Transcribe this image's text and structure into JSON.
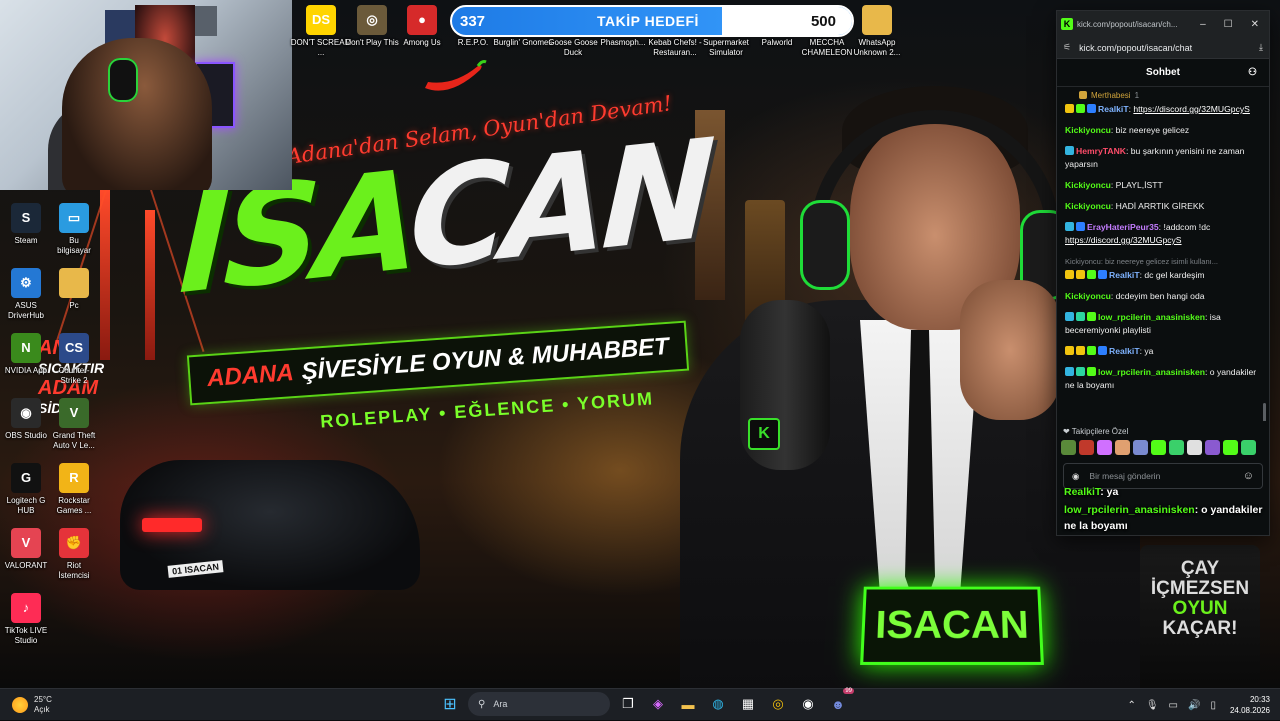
{
  "wallpaper": {
    "brand_left": "ISA",
    "brand_right": "CAN",
    "script_line": "Adana'dan Selam, Oyun'dan Devam!",
    "tagline_accent": "ADANA",
    "tagline_rest": "ŞİVESİYLE OYUN & MUHABBET",
    "subline": "ROLEPLAY • EĞLENCE • YORUM",
    "mic_badge": "K",
    "nameplate": "ISACAN",
    "mug_line1": "ÇAY",
    "mug_line2": "İÇMEZSEN",
    "mug_line3": "OYUN",
    "mug_line4": "KAÇAR!",
    "car_plate": "01 ISACAN",
    "side_text_1": "AN",
    "side_text_2": "SICAKTIR",
    "side_text_3": "ADAM",
    "side_text_4": "SİDİR"
  },
  "desktop_icons": [
    {
      "label": "Steam",
      "icon": "steam-icon",
      "color": "#1b2838",
      "glyph": "S"
    },
    {
      "label": "Bu bilgisayar",
      "icon": "computer-icon",
      "color": "#2a9be0",
      "glyph": "▭"
    },
    {
      "label": "ASUS DriverHub",
      "icon": "asus-icon",
      "color": "#2478d4",
      "glyph": "⚙"
    },
    {
      "label": "Pc",
      "icon": "folder-icon",
      "color": "#e8b84a",
      "glyph": ""
    },
    {
      "label": "NVIDIA App",
      "icon": "nvidia-icon",
      "color": "#3a8a1c",
      "glyph": "N"
    },
    {
      "label": "Counter-Strike 2",
      "icon": "cs2-icon",
      "color": "#2c4a8a",
      "glyph": "CS"
    },
    {
      "label": "OBS Studio",
      "icon": "obs-icon",
      "color": "#2a2a2a",
      "glyph": "◉"
    },
    {
      "label": "Grand Theft Auto V Le...",
      "icon": "gta-icon",
      "color": "#3a6a2a",
      "glyph": "V"
    },
    {
      "label": "Logitech G HUB",
      "icon": "logitech-icon",
      "color": "#111111",
      "glyph": "G"
    },
    {
      "label": "Rockstar Games ...",
      "icon": "rockstar-icon",
      "color": "#f2b417",
      "glyph": "R"
    },
    {
      "label": "VALORANT",
      "icon": "valorant-icon",
      "color": "#e54452",
      "glyph": "V"
    },
    {
      "label": "Riot İstemcisi",
      "icon": "riot-icon",
      "color": "#e5333a",
      "glyph": "✊"
    },
    {
      "label": "TikTok LIVE Studio",
      "icon": "tiktok-icon",
      "color": "#fe2c55",
      "glyph": "♪"
    }
  ],
  "top_icons": [
    {
      "label": "DON'T SCREAM ...",
      "icon": "dont-scream-icon",
      "color": "#ffd400",
      "glyph": "DS"
    },
    {
      "label": "Don't Play This",
      "icon": "dont-play-icon",
      "color": "#6b5a3a",
      "glyph": "◎"
    },
    {
      "label": "Among Us",
      "icon": "among-us-icon",
      "color": "#d62a2a",
      "glyph": "●"
    },
    {
      "label": "R.E.P.O.",
      "icon": "repo-icon",
      "color": "#1e2a34",
      "glyph": ""
    },
    {
      "label": "Burglin' Gnomes",
      "icon": "burglin-gnomes-icon",
      "color": "#4a7a3a",
      "glyph": ""
    },
    {
      "label": "Goose Goose Duck",
      "icon": "goose-icon",
      "color": "#f0c040",
      "glyph": ""
    },
    {
      "label": "Phasmoph...",
      "icon": "phasmophobia-icon",
      "color": "#333333",
      "glyph": ""
    },
    {
      "label": "Kebab Chefs! - Restauran...",
      "icon": "kebab-chefs-icon",
      "color": "#8a3a1a",
      "glyph": ""
    },
    {
      "label": "Supermarket Simulator",
      "icon": "supermarket-icon",
      "color": "#4a6a8a",
      "glyph": "▥"
    },
    {
      "label": "Palworld",
      "icon": "palworld-icon",
      "color": "#5abbd4",
      "glyph": "◕"
    },
    {
      "label": "MECCHA CHAMELEON",
      "icon": "chameleon-icon",
      "color": "#3ab06a",
      "glyph": "☼"
    },
    {
      "label": "WhatsApp Unknown 2...",
      "icon": "folder-icon",
      "color": "#e8b84a",
      "glyph": ""
    }
  ],
  "goal": {
    "current": "337",
    "title": "TAKİP HEDEFİ",
    "target": "500",
    "progress": 0.674
  },
  "browser": {
    "title": "kick.com/popout/isacan/ch...",
    "url": "kick.com/popout/isacan/chat",
    "chat_title": "Sohbet",
    "pinned_label": "Merthabesi",
    "pinned_count": "1",
    "input_placeholder": "Bir mesaj gönderin",
    "emote_title": "Takipçilere Özel"
  },
  "messages": [
    {
      "user": "RealkiT",
      "user_color": "#7fb3ff",
      "text": "",
      "link": "https://discord.gg/32MUGpcyS",
      "badges": [
        "#f1c40f",
        "#53fc18",
        "#2d7fff"
      ]
    },
    {
      "user": "Kickiyoncu",
      "user_color": "#53fc18",
      "text": "biz neereye gelicez",
      "link": "",
      "badges": []
    },
    {
      "user": "HemryTANK",
      "user_color": "#ff4d6a",
      "text": "bu şarkının yenisini ne zaman yaparsın",
      "link": "",
      "badges": [
        "#33b4e0"
      ]
    },
    {
      "user": "Kickiyoncu",
      "user_color": "#53fc18",
      "text": "PLAYL,İSTT",
      "link": "",
      "badges": []
    },
    {
      "user": "Kickiyoncu",
      "user_color": "#53fc18",
      "text": "HADİ ARRTIK GİREKK",
      "link": "",
      "badges": []
    },
    {
      "user": "ErayHateriPeur35",
      "user_color": "#c47dff",
      "text": "!addcom !dc",
      "link": "https://discord.gg/32MUGpcyS",
      "badges": [
        "#33b4e0",
        "#2d7fff"
      ]
    },
    {
      "user": "RealkiT",
      "user_color": "#7fb3ff",
      "text": "dc gel kardeşim",
      "link": "",
      "badges": [
        "#f1c40f",
        "#f1c40f",
        "#53fc18",
        "#2d7fff"
      ],
      "reply_to": "Kickiyoncu: biz neereye gelicez isimli kullanı..."
    },
    {
      "user": "Kickiyoncu",
      "user_color": "#53fc18",
      "text": "dcdeyim ben hangi oda",
      "link": "",
      "badges": []
    },
    {
      "user": "low_rpcilerin_anasinisken",
      "user_color": "#53fc18",
      "text": "isa beceremiyonki playlisti",
      "link": "",
      "badges": [
        "#33b4e0",
        "#2dd4a0",
        "#53fc18"
      ]
    },
    {
      "user": "RealkiT",
      "user_color": "#7fb3ff",
      "text": "ya",
      "link": "",
      "badges": [
        "#f1c40f",
        "#f1c40f",
        "#53fc18",
        "#2d7fff"
      ]
    },
    {
      "user": "low_rpcilerin_anasinisken",
      "user_color": "#53fc18",
      "text": "o yandakiler ne la boyamı",
      "link": "",
      "badges": [
        "#33b4e0",
        "#2dd4a0",
        "#53fc18"
      ]
    }
  ],
  "emotes": [
    "#5a8a3a",
    "#c0392b",
    "#d070ff",
    "#e0a070",
    "#7a8ad0",
    "#53fc18",
    "#3ad06a",
    "#e0e0e0",
    "#8a5ad0",
    "#53fc18",
    "#3ad06a"
  ],
  "overlay_chat": {
    "line1_user": "RealkiT",
    "line1_text": "ya",
    "line2_user": "low_rpcilerin_anasinisken",
    "line2_text": "o yandakiler ne la boyamı"
  },
  "taskbar": {
    "temperature": "25°C",
    "weather": "Açık",
    "search_placeholder": "Ara",
    "time": "20:33",
    "date": "24.08.2026",
    "notification_count": "99"
  }
}
